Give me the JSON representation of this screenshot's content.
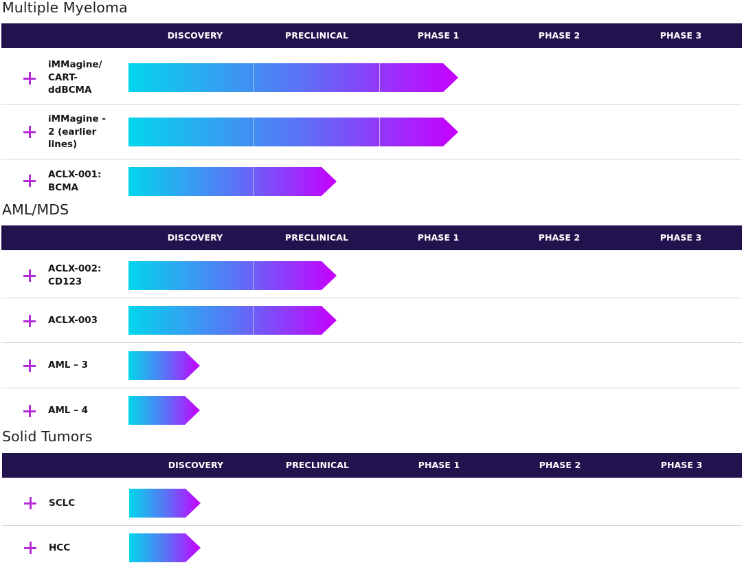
{
  "phases": [
    "DISCOVERY",
    "PRECLINICAL",
    "PHASE 1",
    "PHASE 2",
    "PHASE 3"
  ],
  "colors": {
    "header_bg": "#22124e",
    "plus": "#b32bd7",
    "bar_start": "#04d6ec",
    "bar_end": "#c700ff"
  },
  "sections": [
    {
      "title": "Multiple Myeloma",
      "programs": [
        {
          "name": "iMMagine/\nCART-\nddBCMA",
          "stage": "PHASE 1",
          "stage_index": 3
        },
        {
          "name": "iMMagine -\n2 (earlier\nlines)",
          "stage": "PHASE 1",
          "stage_index": 3
        },
        {
          "name": "ACLX-001:\nBCMA",
          "stage": "PRECLINICAL",
          "stage_index": 2
        }
      ]
    },
    {
      "title": "AML/MDS",
      "programs": [
        {
          "name": "ACLX-002:\nCD123",
          "stage": "PRECLINICAL",
          "stage_index": 2
        },
        {
          "name": "ACLX-003",
          "stage": "PRECLINICAL",
          "stage_index": 2
        },
        {
          "name": "AML – 3",
          "stage": "DISCOVERY",
          "stage_index": 1
        },
        {
          "name": "AML – 4",
          "stage": "DISCOVERY",
          "stage_index": 1
        }
      ]
    },
    {
      "title": "Solid Tumors",
      "programs": [
        {
          "name": "SCLC",
          "stage": "DISCOVERY",
          "stage_index": 1
        },
        {
          "name": "HCC",
          "stage": "DISCOVERY",
          "stage_index": 1
        }
      ]
    }
  ]
}
